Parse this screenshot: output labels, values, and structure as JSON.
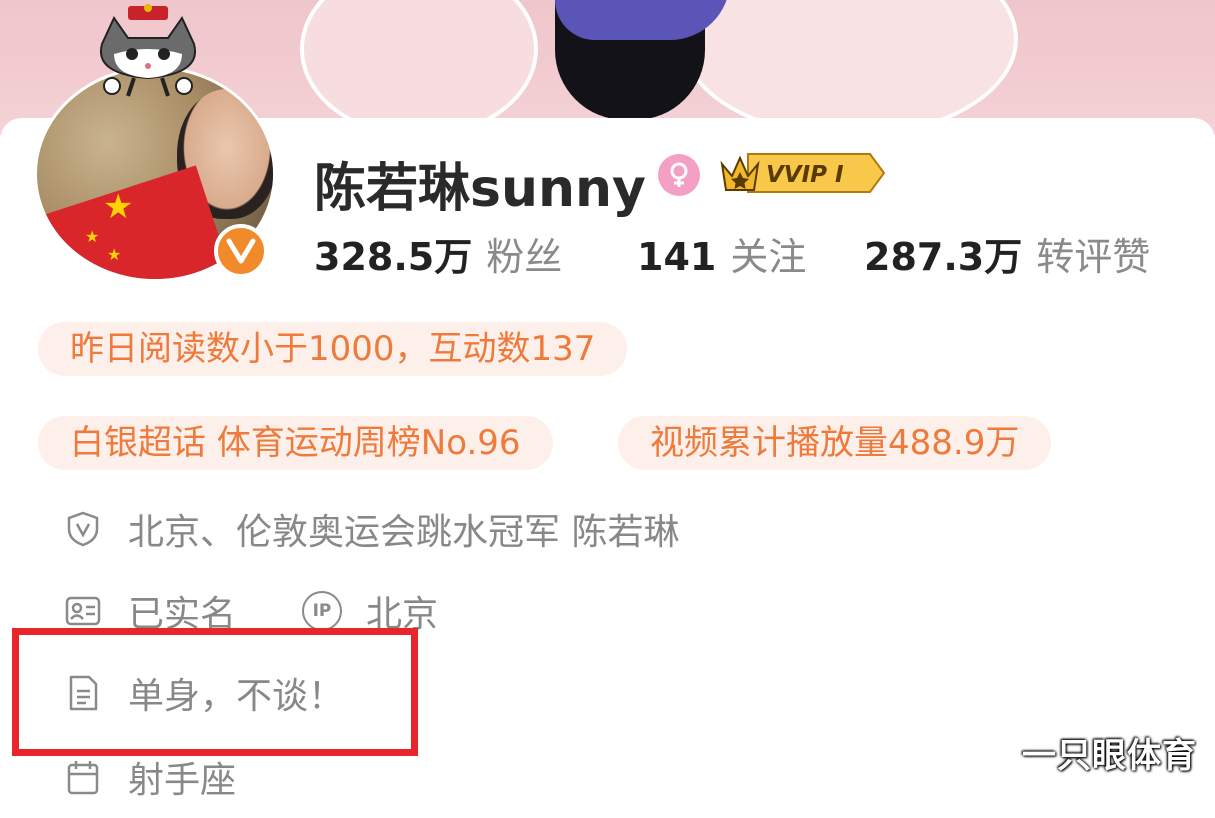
{
  "profile": {
    "name": "陈若琳sunny",
    "vip_label": "VVIP I"
  },
  "stats": [
    {
      "value": "328.5万",
      "label": "粉丝"
    },
    {
      "value": "141",
      "label": "关注"
    },
    {
      "value": "287.3万",
      "label": "转评赞"
    }
  ],
  "tags": [
    "昨日阅读数小于1000，互动数137",
    "白银超话 体育运动周榜No.96",
    "视频累计播放量488.9万"
  ],
  "info": {
    "verification": "北京、伦敦奥运会跳水冠军 陈若琳",
    "real_name": "已实名",
    "ip_label": "IP",
    "ip_location": "北京",
    "bio": "单身，不谈！",
    "zodiac": "射手座"
  },
  "watermark": "一只眼体育",
  "colors": {
    "accent_orange": "#ee7a3c",
    "tag_bg": "#fdf0ea",
    "verify_badge": "#f08a2b",
    "gender_pink": "#f3a0c4",
    "highlight_red": "#e8252b",
    "banner_pink": "#efc6cc"
  },
  "icons": {
    "verification": "shield-v-icon",
    "real_name": "id-card-icon",
    "ip": "ip-icon",
    "bio": "document-icon",
    "zodiac": "calendar-icon",
    "gender": "female-icon",
    "vip": "crown-icon"
  }
}
